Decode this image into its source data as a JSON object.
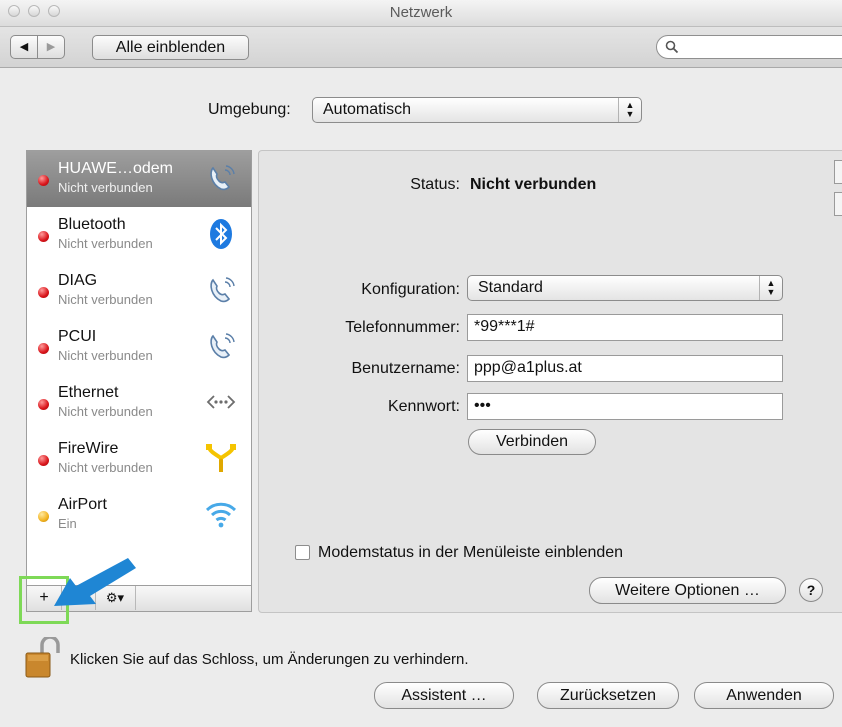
{
  "window": {
    "title": "Netzwerk"
  },
  "toolbar": {
    "back": "◀",
    "forward": "▶",
    "show_all": "Alle einblenden",
    "search_placeholder": ""
  },
  "location": {
    "label": "Umgebung:",
    "value": "Automatisch"
  },
  "services": [
    {
      "name": "HUAWE…odem",
      "status": "Nicht verbunden",
      "dot": "red",
      "icon": "phone-icon",
      "selected": true
    },
    {
      "name": "Bluetooth",
      "status": "Nicht verbunden",
      "dot": "red",
      "icon": "bluetooth-icon",
      "selected": false
    },
    {
      "name": "DIAG",
      "status": "Nicht verbunden",
      "dot": "red",
      "icon": "phone-icon",
      "selected": false
    },
    {
      "name": "PCUI",
      "status": "Nicht verbunden",
      "dot": "red",
      "icon": "phone-icon",
      "selected": false
    },
    {
      "name": "Ethernet",
      "status": "Nicht verbunden",
      "dot": "red",
      "icon": "ethernet-icon",
      "selected": false
    },
    {
      "name": "FireWire",
      "status": "Nicht verbunden",
      "dot": "red",
      "icon": "firewire-icon",
      "selected": false
    },
    {
      "name": "AirPort",
      "status": "Ein",
      "dot": "yellow",
      "icon": "wifi-icon",
      "selected": false
    }
  ],
  "list_bar": {
    "add": "+",
    "remove": "−",
    "gear": "⚙▾"
  },
  "detail": {
    "status_label": "Status:",
    "status_value": "Nicht verbunden",
    "config_label": "Konfiguration:",
    "config_value": "Standard",
    "phone_label": "Telefonnummer:",
    "phone_value": "*99***1#",
    "user_label": "Benutzername:",
    "user_value": "ppp@a1plus.at",
    "password_label": "Kennwort:",
    "password_value": "•••",
    "connect_button": "Verbinden",
    "modem_status_checkbox": "Modemstatus in der Menüleiste einblenden",
    "more_options_button": "Weitere Optionen …",
    "help": "?"
  },
  "footer": {
    "lock_text": "Klicken Sie auf das Schloss, um Änderungen zu verhindern.",
    "assistant_button": "Assistent …",
    "reset_button": "Zurücksetzen",
    "apply_button": "Anwenden"
  },
  "colors": {
    "status_red": "#d9141a",
    "status_yellow": "#f2b320",
    "annotation_arrow": "#1f86d4",
    "annotation_box": "#7ed957",
    "selection": "#8c8c8c"
  }
}
